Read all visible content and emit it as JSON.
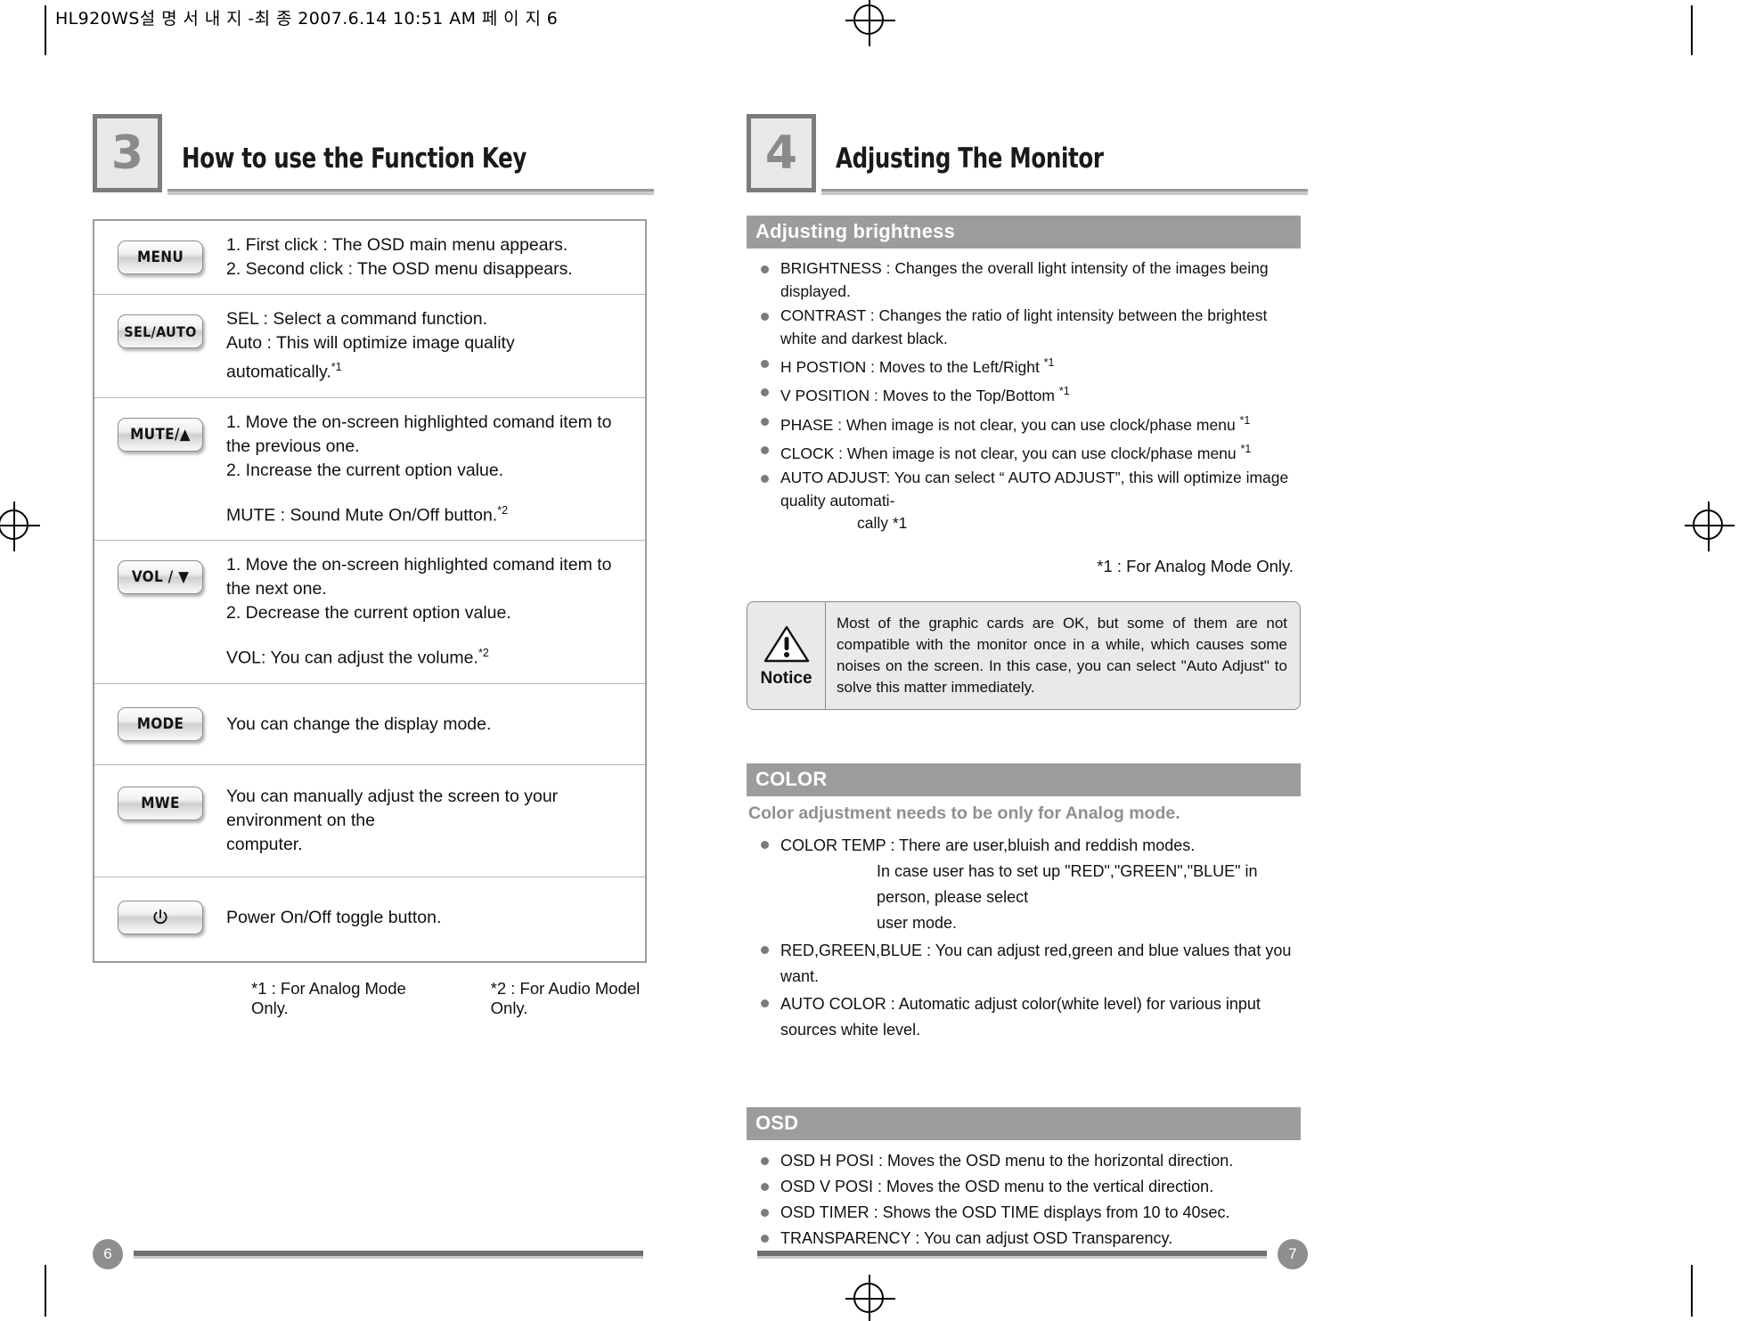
{
  "slug": "HL920WS설 명 서 내 지 -최 종  2007.6.14 10:51 AM 페 이 지 6",
  "left_page": {
    "number": "3",
    "title": "How to use the Function Key",
    "page_label": "6",
    "rows": [
      {
        "key": "MENU",
        "lines": [
          "1. First click : The OSD main menu appears.",
          "2. Second click : The OSD menu disappears."
        ],
        "extra": ""
      },
      {
        "key": "SEL/AUTO",
        "lines": [
          "SEL : Select a command function.",
          "Auto : This will optimize image quality automatically."
        ],
        "line_sup": [
          "",
          "*1"
        ],
        "extra": ""
      },
      {
        "key": "MUTE/▲",
        "lines": [
          "1. Move the on-screen highlighted comand item to the previous one.",
          "2. Increase the current option value."
        ],
        "extra": "MUTE :  Sound Mute On/Off button.",
        "extra_sup": "*2"
      },
      {
        "key": "VOL / ▼",
        "lines": [
          "1. Move the on-screen highlighted comand item to the next one.",
          "2. Decrease the current option value."
        ],
        "extra": "VOL:  You can adjust the volume.",
        "extra_sup": "*2"
      },
      {
        "key": "MODE",
        "lines": [
          "You can change the display mode."
        ],
        "extra": ""
      },
      {
        "key": "MWE",
        "lines": [
          "You can manually adjust the screen to your environment on the",
          "computer."
        ],
        "extra": ""
      },
      {
        "key": "power-icon",
        "lines": [
          "Power On/Off toggle button."
        ],
        "extra": ""
      }
    ],
    "footnote_1": "*1 : For Analog Mode Only.",
    "footnote_2": "*2 : For Audio Model Only."
  },
  "right_page": {
    "number": "4",
    "title": "Adjusting The Monitor",
    "page_label": "7",
    "brightness": {
      "bar_label": "Adjusting brightness",
      "items": [
        {
          "text": "BRIGHTNESS : Changes the overall light intensity of the images being displayed.",
          "sup": ""
        },
        {
          "text": "CONTRAST : Changes the ratio of light intensity between the brightest white and darkest black.",
          "sup": ""
        },
        {
          "text": "H POSTION : Moves to the Left/Right ",
          "sup": "*1"
        },
        {
          "text": "V POSITION : Moves to the Top/Bottom ",
          "sup": "*1"
        },
        {
          "text": "PHASE : When image is not clear, you can use clock/phase menu ",
          "sup": "*1"
        },
        {
          "text": "CLOCK : When image is not clear, you can use clock/phase menu ",
          "sup": "*1"
        },
        {
          "text": "AUTO ADJUST: You can select “ AUTO ADJUST”, this will optimize image quality automati-",
          "sup": "",
          "cont": "cally *1"
        }
      ],
      "analog_note": "*1 : For Analog Mode Only."
    },
    "notice": {
      "label": "Notice",
      "text": "Most of the graphic cards are OK, but some of them are not compatible with the monitor once in a while, which causes some noises on the screen. In this case, you can select \"Auto Adjust\" to solve this matter immediately."
    },
    "color": {
      "bar_label": "COLOR",
      "subhead": "Color adjustment needs to be only for Analog mode.",
      "items": [
        {
          "text": "COLOR TEMP : There are user,bluish and reddish modes.",
          "cont1": "In case user has to set up \"RED\",\"GREEN\",\"BLUE\" in person, please select",
          "cont2": "user mode."
        },
        {
          "text": "RED,GREEN,BLUE : You can adjust red,green and blue values that you want."
        },
        {
          "text": "AUTO COLOR : Automatic adjust color(white level) for various input sources white level."
        }
      ]
    },
    "osd": {
      "bar_label": "OSD",
      "items": [
        "OSD H POSI : Moves the OSD menu to the horizontal direction.",
        "OSD V POSI : Moves the OSD menu to the vertical direction.",
        "OSD TIMER : Shows the OSD TIME displays from 10 to 40sec.",
        "TRANSPARENCY : You can adjust OSD Transparency."
      ]
    }
  },
  "colors": {
    "bar_gray": "#9c9c9c",
    "rule_gray": "#c9c9c9",
    "key_border": "#8d8d8d",
    "page_badge": "#8e8e8e"
  }
}
